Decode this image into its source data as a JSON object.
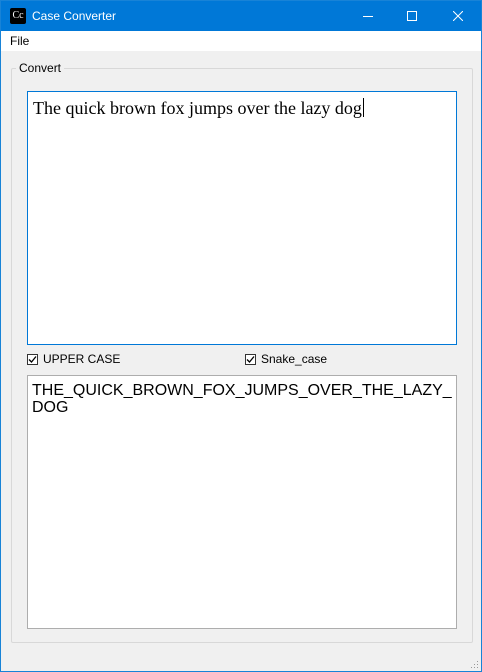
{
  "window": {
    "title": "Case Converter",
    "icon_text": "Cc",
    "controls": {
      "minimize": "minimize-icon",
      "maximize": "maximize-icon",
      "close": "close-icon"
    }
  },
  "menu": {
    "file_label": "File"
  },
  "group": {
    "legend": "Convert"
  },
  "input": {
    "value": "The quick brown fox jumps over the lazy dog"
  },
  "options": {
    "upper_case_label": "UPPER CASE",
    "upper_case_checked": true,
    "snake_case_label": "Snake_case",
    "snake_case_checked": true
  },
  "output": {
    "value": "THE_QUICK_BROWN_FOX_JUMPS_OVER_THE_LAZY_DOG"
  },
  "colors": {
    "titlebar": "#0078d7",
    "focus_border": "#0078d7",
    "background": "#f0f0f0"
  }
}
